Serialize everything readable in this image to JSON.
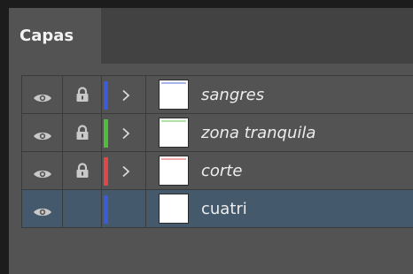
{
  "panel": {
    "tab_label": "Capas",
    "icons": {
      "visibility": "eye-icon",
      "lock": "lock-icon",
      "expand": "chevron-right-icon"
    }
  },
  "layers": [
    {
      "name": "sangres",
      "color": "#3d5bd6",
      "locked": true,
      "expandable": true,
      "selected": false,
      "italic": true
    },
    {
      "name": "zona tranquila",
      "color": "#4fbf3a",
      "locked": true,
      "expandable": true,
      "selected": false,
      "italic": true
    },
    {
      "name": "corte",
      "color": "#e04848",
      "locked": true,
      "expandable": true,
      "selected": false,
      "italic": true
    },
    {
      "name": "cuatri",
      "color": "#3d5bd6",
      "locked": false,
      "expandable": false,
      "selected": true,
      "italic": false
    }
  ]
}
